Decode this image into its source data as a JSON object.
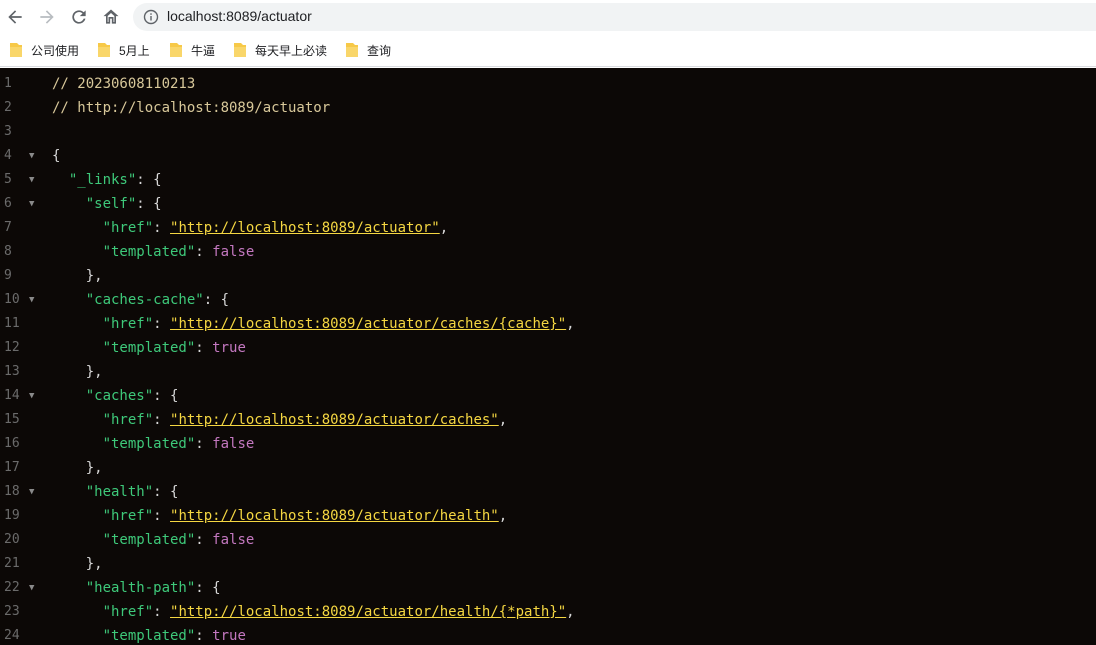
{
  "browser": {
    "url": "localhost:8089/actuator",
    "bookmarks": [
      "公司使用",
      "5月上",
      "牛逼",
      "每天早上必读",
      "查询"
    ]
  },
  "code": {
    "line_numbers": [
      "1",
      "2",
      "3",
      "4",
      "5",
      "6",
      "7",
      "8",
      "9",
      "10",
      "11",
      "12",
      "13",
      "14",
      "15",
      "16",
      "17",
      "18",
      "19",
      "20",
      "21",
      "22",
      "23",
      "24"
    ],
    "comment_date": "// 20230608110213",
    "comment_url": "// http://localhost:8089/actuator",
    "open_brace": "{",
    "links_key": "\"_links\"",
    "self_key": "\"self\"",
    "caches_cache_key": "\"caches-cache\"",
    "caches_key": "\"caches\"",
    "health_key": "\"health\"",
    "health_path_key": "\"health-path\"",
    "href_key": "\"href\"",
    "templated_key": "\"templated\"",
    "self_href": "\"http://localhost:8089/actuator\"",
    "caches_cache_href": "\"http://localhost:8089/actuator/caches/{cache}\"",
    "caches_href": "\"http://localhost:8089/actuator/caches\"",
    "health_href": "\"http://localhost:8089/actuator/health\"",
    "health_path_href": "\"http://localhost:8089/actuator/health/{*path}\"",
    "val_false": "false",
    "val_true": "true",
    "colon_brace": ": {",
    "colon": ": ",
    "comma": ",",
    "close_brace_comma": "},"
  }
}
